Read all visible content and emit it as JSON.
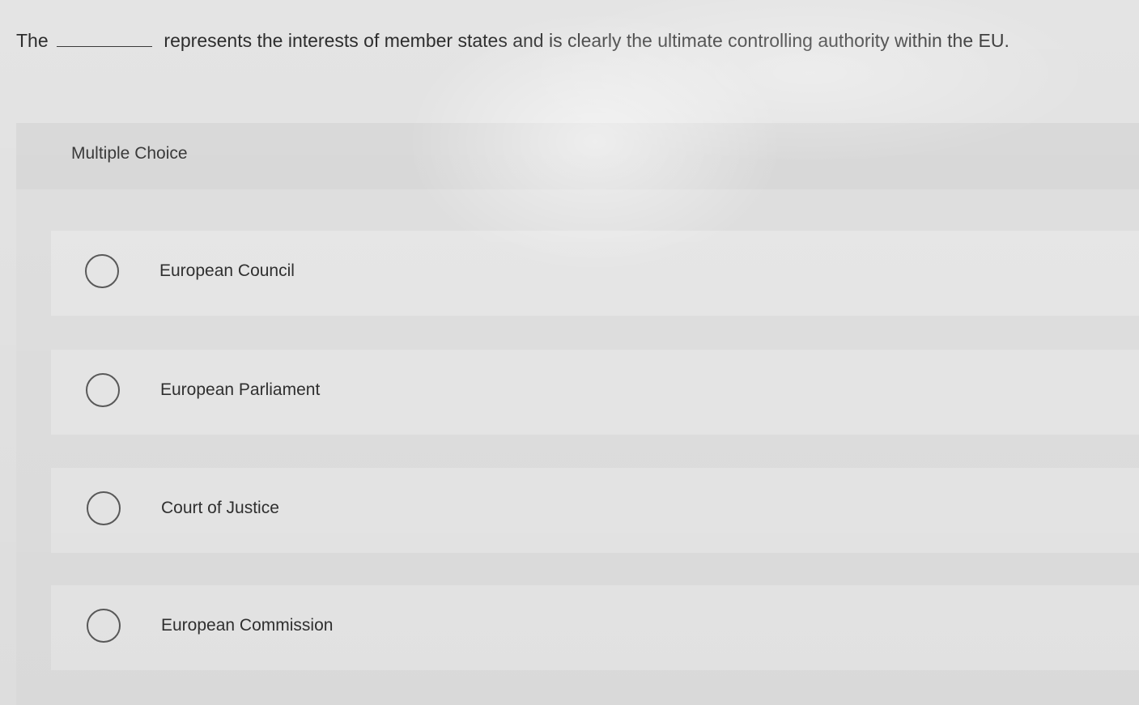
{
  "question": {
    "prefix": "The",
    "suffix": "represents the interests of member states and is clearly the ultimate controlling authority within the EU."
  },
  "panel": {
    "title": "Multiple Choice"
  },
  "options": [
    {
      "label": "European Council"
    },
    {
      "label": "European Parliament"
    },
    {
      "label": "Court of Justice"
    },
    {
      "label": "European Commission"
    }
  ]
}
